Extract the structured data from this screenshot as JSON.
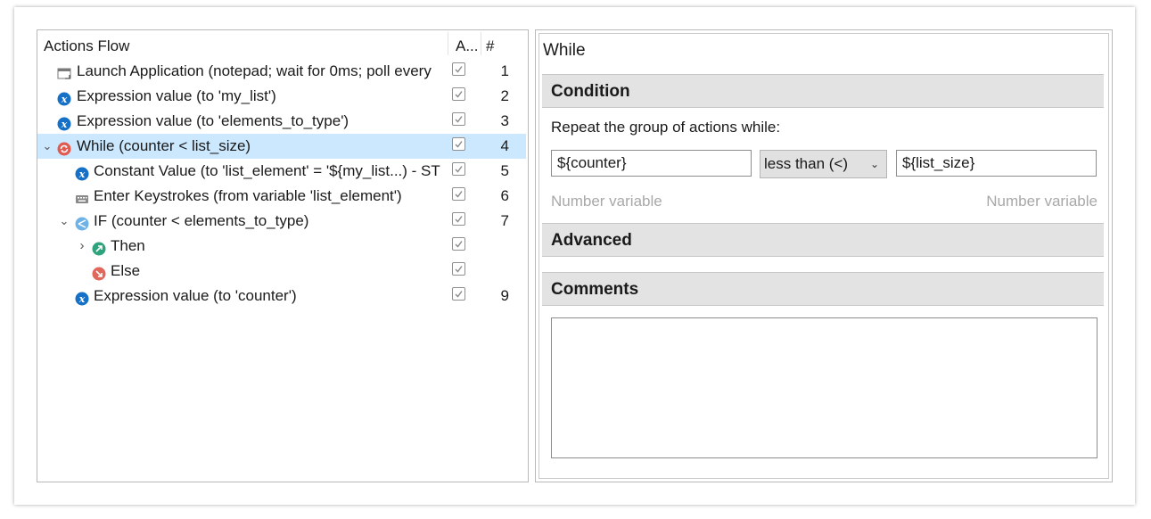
{
  "tree": {
    "header": {
      "name": "Actions Flow",
      "active": "A...",
      "number": "#"
    },
    "rows": [
      {
        "label": "Launch Application (notepad; wait for 0ms; poll every",
        "num": "1",
        "icon": "launch-app-icon"
      },
      {
        "label": "Expression value (to 'my_list')",
        "num": "2",
        "icon": "expression-icon"
      },
      {
        "label": "Expression value (to 'elements_to_type')",
        "num": "3",
        "icon": "expression-icon"
      },
      {
        "label": "While (counter < list_size)",
        "num": "4",
        "icon": "while-loop-icon"
      },
      {
        "label": "Constant Value (to 'list_element' = '${my_list...) - ST",
        "num": "5",
        "icon": "expression-icon"
      },
      {
        "label": "Enter Keystrokes (from variable 'list_element')",
        "num": "6",
        "icon": "keyboard-icon"
      },
      {
        "label": "IF (counter < elements_to_type)",
        "num": "7",
        "icon": "if-branch-icon"
      },
      {
        "label": "Then",
        "num": "",
        "icon": "then-icon"
      },
      {
        "label": "Else",
        "num": "",
        "icon": "else-icon"
      },
      {
        "label": "Expression value (to 'counter')",
        "num": "9",
        "icon": "expression-icon"
      }
    ]
  },
  "detail": {
    "title": "While",
    "condition": {
      "header": "Condition",
      "description": "Repeat the group of actions while:",
      "left_value": "${counter}",
      "operator": "less than (<)",
      "right_value": "${list_size}",
      "left_hint": "Number variable",
      "right_hint": "Number variable"
    },
    "advanced": {
      "header": "Advanced"
    },
    "comments": {
      "header": "Comments",
      "value": ""
    }
  },
  "colors": {
    "selection": "#cce8ff",
    "expression_blue": "#1570c7",
    "while_red": "#e05a4f",
    "if_blue": "#6fb3e6",
    "then_green": "#2fa37d",
    "else_red": "#e0675a"
  }
}
